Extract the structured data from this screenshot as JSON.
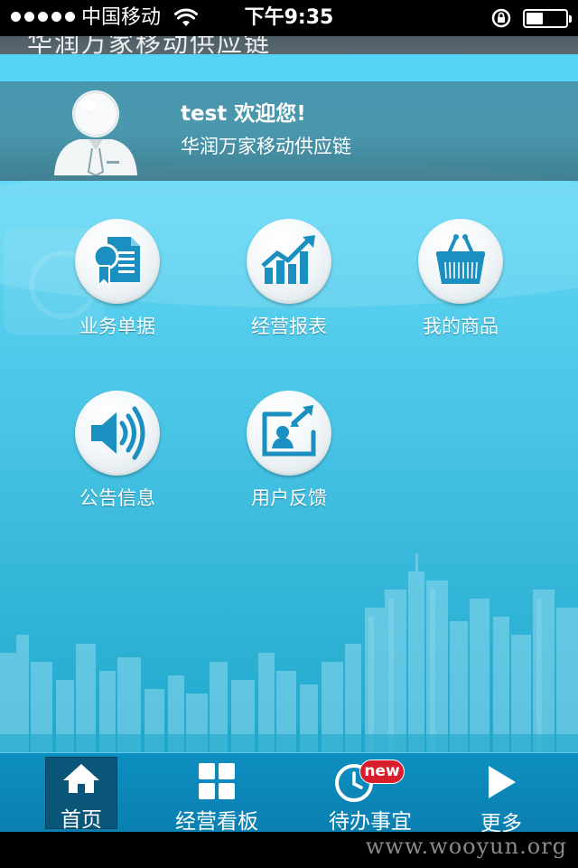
{
  "status_bar": {
    "carrier": "中国移动",
    "time": "下午9:35",
    "signal_dots": 5,
    "battery_fraction": 0.3
  },
  "header": {
    "title_partial": "华润万家移动供应链"
  },
  "user": {
    "welcome": "test 欢迎您!",
    "subtitle": "华润万家移动供应链"
  },
  "menu": {
    "items": [
      {
        "label": "业务单据",
        "icon": "certificate-document-icon"
      },
      {
        "label": "经营报表",
        "icon": "growth-chart-icon"
      },
      {
        "label": "我的商品",
        "icon": "shopping-basket-icon"
      },
      {
        "label": "公告信息",
        "icon": "speaker-icon"
      },
      {
        "label": "用户反馈",
        "icon": "feedback-arrows-icon"
      }
    ]
  },
  "tabbar": {
    "tabs": [
      {
        "label": "首页",
        "icon": "home-icon",
        "active": true
      },
      {
        "label": "经营看板",
        "icon": "grid-icon",
        "active": false
      },
      {
        "label": "待办事宜",
        "icon": "clock-icon",
        "active": false,
        "badge": "new"
      },
      {
        "label": "更多",
        "icon": "play-arrow-icon",
        "active": false
      }
    ]
  },
  "colors": {
    "main_top": "#53d4f6",
    "main_bottom": "#1fa8cc",
    "tabbar": "#0d8fc0",
    "tab_active": "#0a5679",
    "icon_blue": "#1a8fc0",
    "badge_red": "#d81d2c"
  },
  "footer": {
    "watermark": "www.wooyun.org"
  }
}
